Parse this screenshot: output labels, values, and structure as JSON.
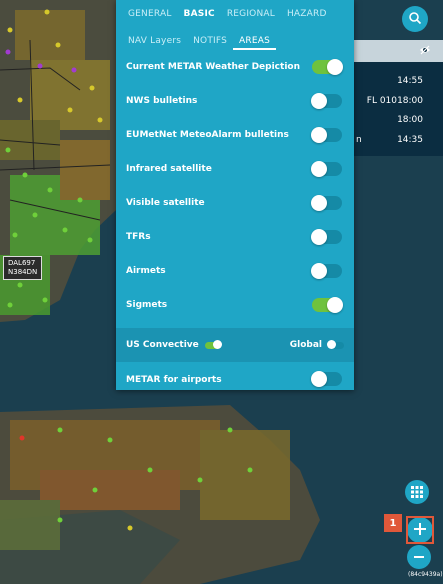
{
  "tabs_row1": [
    "GENERAL",
    "BASIC",
    "REGIONAL",
    "HAZARD"
  ],
  "active_tab": "BASIC",
  "tabs_row2": [
    "NAV Layers",
    "NOTIFS",
    "AREAS"
  ],
  "layers": [
    {
      "label": "Current METAR Weather Depiction",
      "on": true
    },
    {
      "label": "NWS bulletins",
      "on": false
    },
    {
      "label": "EUMetNet MeteoAlarm bulletins",
      "on": false
    },
    {
      "label": "Infrared satellite",
      "on": false
    },
    {
      "label": "Visible satellite",
      "on": false
    },
    {
      "label": "TFRs",
      "on": false
    },
    {
      "label": "Airmets",
      "on": false
    },
    {
      "label": "Sigmets",
      "on": true
    }
  ],
  "sigmet_options": {
    "us_convective_label": "US Convective",
    "us_convective_on": true,
    "global_label": "Global",
    "global_on": false
  },
  "metar_airports": {
    "label": "METAR for airports",
    "on": false
  },
  "flight_label": {
    "callsign": "DAL697",
    "registration": "N384DN"
  },
  "right_panel": {
    "row1": "14:55",
    "row2_level": "FL 010",
    "row2_time": "18:00",
    "row3": "18:00",
    "row4_prefix": "n",
    "row4_time": "14:35"
  },
  "badge_number": "1",
  "version": "(84c9439a)",
  "icons": [
    "search-icon",
    "eye-slash-icon",
    "grid-icon",
    "zoom-in-icon",
    "zoom-out-icon"
  ],
  "colors": {
    "panel": "#1fa6c6",
    "toggle_on": "#6fc23d",
    "highlight": "#e0583a"
  }
}
